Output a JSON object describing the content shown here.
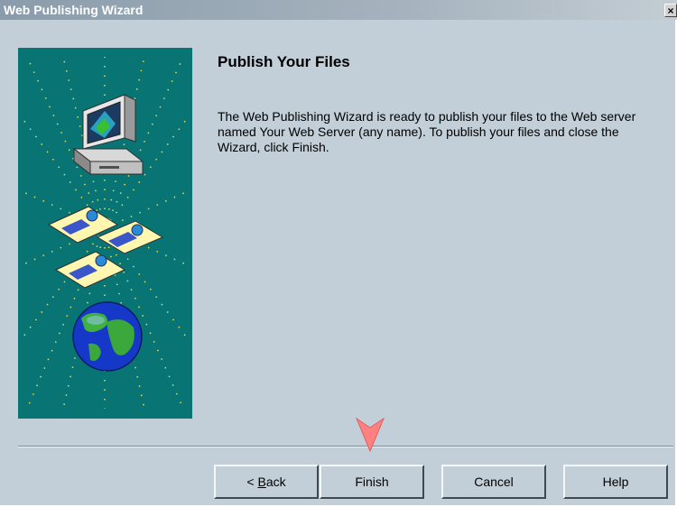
{
  "window": {
    "title": "Web Publishing Wizard",
    "close_glyph": "×"
  },
  "page": {
    "heading": "Publish Your Files",
    "body": "The Web Publishing Wizard is ready to publish your files to the Web server named Your Web Server (any name). To publish your files and close the Wizard, click Finish."
  },
  "buttons": {
    "back_prefix": "< ",
    "back_mnemonic": "B",
    "back_rest": "ack",
    "finish": "Finish",
    "cancel": "Cancel",
    "help": "Help"
  },
  "colors": {
    "dialog_bg": "#c2cfd8",
    "illustration_bg": "#087474",
    "pointer": "#ff8080"
  },
  "icons": [
    "computer-icon",
    "document-icon",
    "globe-icon",
    "arrow-pointer-icon"
  ]
}
